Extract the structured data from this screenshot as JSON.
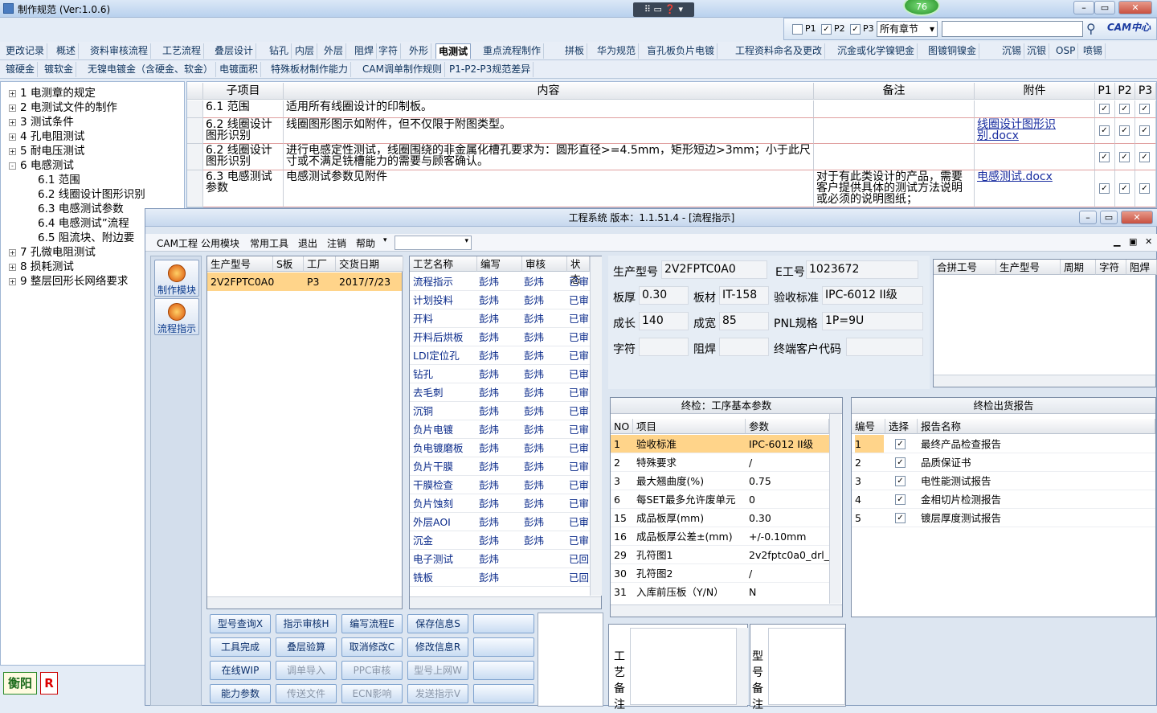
{
  "app": {
    "title": "制作规范 (Ver:1.0.6)",
    "badge": "76"
  },
  "toolbar": {
    "p1": "P1",
    "p2": "P2",
    "p3": "P3",
    "chapter_select": "所有章节",
    "logo": "CAM中心"
  },
  "tabs_row1": [
    "更改记录",
    "概述",
    "资料审核流程",
    "工艺流程",
    "叠层设计",
    "钻孔",
    "内层",
    "外层",
    "阻焊",
    "字符",
    "外形",
    "电测试",
    "重点流程制作",
    "拼板",
    "华为规范",
    "盲孔板负片电镀",
    "工程资料命名及更改",
    "沉金或化学镍钯金",
    "图镀铜镍金",
    "沉锡",
    "沉银",
    "OSP",
    "喷锡"
  ],
  "tabs_row2": [
    "镀硬金",
    "镀软金",
    "无镍电镀金（含硬金、软金）",
    "电镀面积",
    "特殊板材制作能力",
    "CAM调单制作规则",
    "P1-P2-P3规范差异"
  ],
  "tree": [
    {
      "sign": "+",
      "text": "1  电测章的规定"
    },
    {
      "sign": "+",
      "text": "2  电测试文件的制作"
    },
    {
      "sign": "+",
      "text": "3  测试条件"
    },
    {
      "sign": "+",
      "text": "4  孔电阻测试"
    },
    {
      "sign": "+",
      "text": "5  耐电压测试"
    },
    {
      "sign": "-",
      "text": "6  电感测试"
    },
    {
      "sign": "",
      "text": "6.1  范围"
    },
    {
      "sign": "",
      "text": "6.2  线圈设计图形识别"
    },
    {
      "sign": "",
      "text": "6.3  电感测试参数"
    },
    {
      "sign": "",
      "text": "6.4  电感测试”流程"
    },
    {
      "sign": "",
      "text": "6.5  阻流块、附边要"
    },
    {
      "sign": "+",
      "text": "7  孔微电阻测试"
    },
    {
      "sign": "+",
      "text": "8  损耗测试"
    },
    {
      "sign": "+",
      "text": "9  整层回形长网络要求"
    }
  ],
  "grid": {
    "headers": [
      "子项目",
      "内容",
      "备注",
      "附件",
      "P1",
      "P2",
      "P3"
    ],
    "rows": [
      {
        "sub": "6.1  范围",
        "content": "适用所有线圈设计的印制板。",
        "note": "",
        "attach": ""
      },
      {
        "sub": "6.2  线圈设计图形识别",
        "content": "线圈图形图示如附件，但不仅限于附图类型。",
        "note": "",
        "attach": "线圈设计图形识别.docx"
      },
      {
        "sub": "6.2  线圈设计图形识别",
        "content": "进行电感定性测试，线圈围绕的非金属化槽孔要求为：圆形直径>=4.5mm，矩形短边>3mm；小于此尺寸或不满足铣槽能力的需要与顾客确认。",
        "note": "",
        "attach": ""
      },
      {
        "sub": "6.3  电感测试参数",
        "content": "电感测试参数见附件",
        "note": "对于有此类设计的产品，需要客户提供具体的测试方法说明或必须的说明图纸；",
        "attach": "电感测试.docx"
      }
    ]
  },
  "status": {
    "city": "衡阳",
    "flag": "R"
  },
  "sys": {
    "title": "工程系统  版本：1.1.51.4 - [流程指示]",
    "menu": [
      "CAM工程",
      "公用模块",
      "常用工具",
      "退出",
      "注销",
      "帮助"
    ],
    "side": [
      "制作模块",
      "流程指示"
    ],
    "orders": {
      "headers": [
        "生产型号",
        "S板",
        "工厂",
        "交货日期"
      ],
      "rows": [
        [
          "2V2FPTC0A0",
          "",
          "P3",
          "2017/7/23"
        ]
      ]
    },
    "steps": {
      "headers": [
        "工艺名称",
        "编写",
        "审核",
        "状态"
      ],
      "rows": [
        [
          "流程指示",
          "彭炜",
          "彭炜",
          "已审"
        ],
        [
          "计划投料",
          "彭炜",
          "彭炜",
          "已审"
        ],
        [
          "开料",
          "彭炜",
          "彭炜",
          "已审"
        ],
        [
          "开料后烘板",
          "彭炜",
          "彭炜",
          "已审"
        ],
        [
          "LDI定位孔",
          "彭炜",
          "彭炜",
          "已审"
        ],
        [
          "钻孔",
          "彭炜",
          "彭炜",
          "已审"
        ],
        [
          "去毛刺",
          "彭炜",
          "彭炜",
          "已审"
        ],
        [
          "沉铜",
          "彭炜",
          "彭炜",
          "已审"
        ],
        [
          "负片电镀",
          "彭炜",
          "彭炜",
          "已审"
        ],
        [
          "负电镀磨板",
          "彭炜",
          "彭炜",
          "已审"
        ],
        [
          "负片干膜",
          "彭炜",
          "彭炜",
          "已审"
        ],
        [
          "干膜检查",
          "彭炜",
          "彭炜",
          "已审"
        ],
        [
          "负片蚀刻",
          "彭炜",
          "彭炜",
          "已审"
        ],
        [
          "外层AOI",
          "彭炜",
          "彭炜",
          "已审"
        ],
        [
          "沉金",
          "彭炜",
          "彭炜",
          "已审"
        ],
        [
          "电子测试",
          "彭炜",
          "",
          "已回"
        ],
        [
          "铣板",
          "彭炜",
          "",
          "已回"
        ]
      ]
    },
    "buttons": [
      [
        "型号查询X",
        "指示审核H",
        "编写流程E",
        "保存信息S",
        ""
      ],
      [
        "工具完成",
        "叠层验算",
        "取消修改C",
        "修改信息R",
        ""
      ],
      [
        "在线WIP",
        "调单导入",
        "PPC审核",
        "型号上网W",
        ""
      ],
      [
        "能力参数",
        "传送文件",
        "ECN影响",
        "发送指示V",
        ""
      ]
    ],
    "info": {
      "prod_label": "生产型号",
      "prod": "2V2FPTC0A0",
      "e_label": "E工号",
      "e": "1023672",
      "thick_label": "板厚",
      "thick": "0.30",
      "mat_label": "板材",
      "mat": "IT-158",
      "std_label": "验收标准",
      "std": "IPC-6012 II级",
      "len_label": "成长",
      "len": "140",
      "wid_label": "成宽",
      "wid": "85",
      "pnl_label": "PNL规格",
      "pnl": "1P=9U",
      "char_label": "字符",
      "char": "",
      "mask_label": "阻焊",
      "mask": "",
      "cust_label": "终端客户代码",
      "cust": ""
    },
    "merge": {
      "headers": [
        "合拼工号",
        "生产型号",
        "周期",
        "字符",
        "阻焊"
      ]
    },
    "params": {
      "title": "终检：工序基本参数",
      "headers": [
        "NO",
        "项目",
        "参数"
      ],
      "rows": [
        [
          "1",
          "验收标准",
          "IPC-6012 II级"
        ],
        [
          "2",
          "特殊要求",
          "/"
        ],
        [
          "3",
          "最大翘曲度(%)",
          "0.75"
        ],
        [
          "6",
          "每SET最多允许废单元",
          "0"
        ],
        [
          "15",
          "成品板厚(mm)",
          "0.30"
        ],
        [
          "16",
          "成品板厚公差±(mm)",
          "+/-0.10mm"
        ],
        [
          "29",
          "孔符图1",
          "2v2fptc0a0_drl_"
        ],
        [
          "30",
          "孔符图2",
          "/"
        ],
        [
          "31",
          "入库前压板（Y/N）",
          "N"
        ]
      ]
    },
    "reports": {
      "title": "终检出货报告",
      "headers": [
        "编号",
        "选择",
        "报告名称"
      ],
      "rows": [
        [
          "1",
          "最终产品检查报告"
        ],
        [
          "2",
          "品质保证书"
        ],
        [
          "3",
          "电性能测试报告"
        ],
        [
          "4",
          "金相切片检测报告"
        ],
        [
          "5",
          "镀层厚度测试报告"
        ]
      ]
    },
    "notes": {
      "craft": "工艺备注",
      "model": "型号备注"
    }
  }
}
